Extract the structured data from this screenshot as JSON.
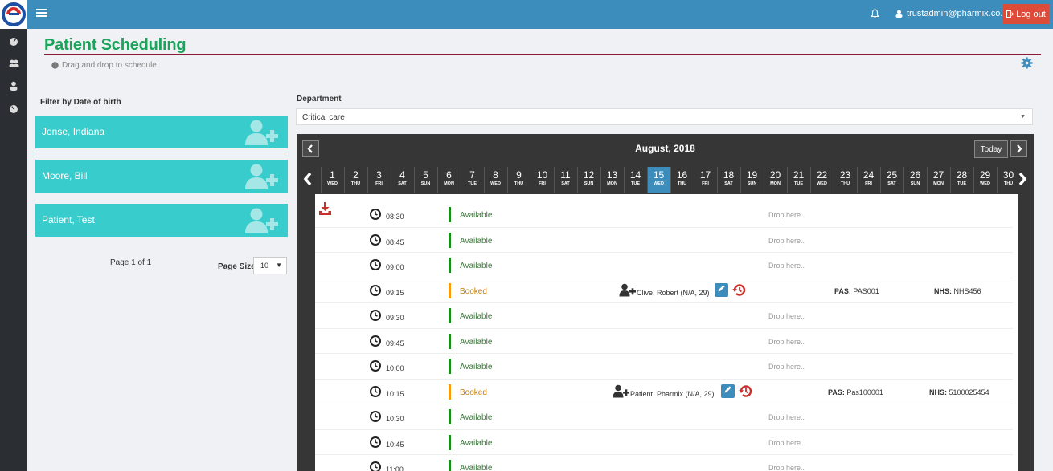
{
  "topbar": {
    "user_email": "trustadmin@pharmix.co.uk",
    "logout_label": "Log out"
  },
  "page": {
    "title": "Patient Scheduling",
    "hint": "Drag and drop to schedule"
  },
  "filter": {
    "label": "Filter by Date of birth",
    "patients": [
      "Jonse, Indiana",
      "Moore, Bill",
      "Patient, Test"
    ],
    "page_info": "Page 1 of 1",
    "page_size_label": "Page Size",
    "page_size_value": "10"
  },
  "department": {
    "label": "Department",
    "value": "Critical care"
  },
  "calendar": {
    "month": "August, 2018",
    "today_label": "Today",
    "days": [
      {
        "n": "1",
        "d": "WED"
      },
      {
        "n": "2",
        "d": "THU"
      },
      {
        "n": "3",
        "d": "FRI"
      },
      {
        "n": "4",
        "d": "SAT"
      },
      {
        "n": "5",
        "d": "SUN"
      },
      {
        "n": "6",
        "d": "MON"
      },
      {
        "n": "7",
        "d": "TUE"
      },
      {
        "n": "8",
        "d": "WED"
      },
      {
        "n": "9",
        "d": "THU"
      },
      {
        "n": "10",
        "d": "FRI"
      },
      {
        "n": "11",
        "d": "SAT"
      },
      {
        "n": "12",
        "d": "SUN"
      },
      {
        "n": "13",
        "d": "MON"
      },
      {
        "n": "14",
        "d": "TUE"
      },
      {
        "n": "15",
        "d": "WED"
      },
      {
        "n": "16",
        "d": "THU"
      },
      {
        "n": "17",
        "d": "FRI"
      },
      {
        "n": "18",
        "d": "SAT"
      },
      {
        "n": "19",
        "d": "SUN"
      },
      {
        "n": "20",
        "d": "MON"
      },
      {
        "n": "21",
        "d": "TUE"
      },
      {
        "n": "22",
        "d": "WED"
      },
      {
        "n": "23",
        "d": "THU"
      },
      {
        "n": "24",
        "d": "FRI"
      },
      {
        "n": "25",
        "d": "SAT"
      },
      {
        "n": "26",
        "d": "SUN"
      },
      {
        "n": "27",
        "d": "MON"
      },
      {
        "n": "28",
        "d": "TUE"
      },
      {
        "n": "29",
        "d": "WED"
      },
      {
        "n": "30",
        "d": "THU"
      }
    ],
    "active_day": "15"
  },
  "schedule": {
    "drop_text": "Drop here..",
    "slots": [
      {
        "time": "08:30",
        "status": "Available"
      },
      {
        "time": "08:45",
        "status": "Available"
      },
      {
        "time": "09:00",
        "status": "Available"
      },
      {
        "time": "09:15",
        "status": "Booked",
        "patient": "Clive, Robert (N/A, 29)",
        "pas_label": "PAS:",
        "pas": "PAS001",
        "nhs_label": "NHS:",
        "nhs": "NHS456"
      },
      {
        "time": "09:30",
        "status": "Available"
      },
      {
        "time": "09:45",
        "status": "Available"
      },
      {
        "time": "10:00",
        "status": "Available"
      },
      {
        "time": "10:15",
        "status": "Booked",
        "patient": "Patient, Pharmix (N/A, 29)",
        "pas_label": "PAS:",
        "pas": "Pas100001",
        "nhs_label": "NHS:",
        "nhs": "5100025454"
      },
      {
        "time": "10:30",
        "status": "Available"
      },
      {
        "time": "10:45",
        "status": "Available"
      },
      {
        "time": "11:00",
        "status": "Available"
      }
    ]
  },
  "colors": {
    "topbar": "#3c8dbc",
    "title": "#1aa45a",
    "card": "#39cccc",
    "available": "#1a8a1a",
    "booked": "#f39c12",
    "logout": "#dd4b39"
  }
}
